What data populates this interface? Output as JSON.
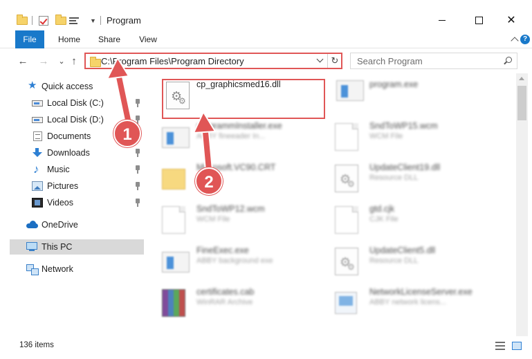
{
  "window": {
    "title": "Program",
    "controls": {
      "minimize": "—",
      "maximize": "☐",
      "close": "✕"
    }
  },
  "ribbon": {
    "tabs": [
      {
        "label": "File"
      },
      {
        "label": "Home"
      },
      {
        "label": "Share"
      },
      {
        "label": "View"
      }
    ],
    "help": "?"
  },
  "navigation": {
    "back": "←",
    "forward": "→",
    "recent": "⌄",
    "up": "↑",
    "address": "C:\\Program Files\\Program Directory",
    "refresh": "↻",
    "search_placeholder": "Search Program"
  },
  "sidebar": {
    "items": [
      {
        "label": "Quick access",
        "icon": "star-icon",
        "pinned": false
      },
      {
        "label": "Local Disk (C:)",
        "icon": "drive-icon",
        "pinned": true
      },
      {
        "label": "Local Disk (D:)",
        "icon": "drive-icon",
        "pinned": true
      },
      {
        "label": "Documents",
        "icon": "documents-icon",
        "pinned": true
      },
      {
        "label": "Downloads",
        "icon": "downloads-icon",
        "pinned": true
      },
      {
        "label": "Music",
        "icon": "music-icon",
        "pinned": true
      },
      {
        "label": "Pictures",
        "icon": "pictures-icon",
        "pinned": true
      },
      {
        "label": "Videos",
        "icon": "videos-icon",
        "pinned": true
      },
      {
        "label": "OneDrive",
        "icon": "cloud-icon",
        "pinned": false
      },
      {
        "label": "This PC",
        "icon": "computer-icon",
        "pinned": false,
        "selected": true
      },
      {
        "label": "Network",
        "icon": "network-icon",
        "pinned": false
      }
    ]
  },
  "files": [
    {
      "name": "cp_graphicsmed16.dll",
      "desc": "",
      "icon": "dll-file-icon"
    },
    {
      "name": "program.exe",
      "desc": "",
      "icon": "exe-file-icon"
    },
    {
      "name": "programmInstaller.exe",
      "desc": "ABBY fineeader In...",
      "icon": "exe-file-icon"
    },
    {
      "name": "SndToWP15.wcm",
      "desc": "WCM File",
      "icon": "wcm-file-icon"
    },
    {
      "name": "Microsoft.VC90.CRT",
      "desc": "",
      "icon": "folder-icon"
    },
    {
      "name": "UpdateClient19.dll",
      "desc": "Resource DLL",
      "icon": "dll-file-icon"
    },
    {
      "name": "SndToWP12.wcm",
      "desc": "WCM File",
      "icon": "wcm-file-icon"
    },
    {
      "name": "gtd.cjk",
      "desc": "CJK File",
      "icon": "cjk-file-icon"
    },
    {
      "name": "FineExec.exe",
      "desc": "ABBY background exe",
      "icon": "exe-file-icon"
    },
    {
      "name": "UpdateClient5.dll",
      "desc": "Resource DLL",
      "icon": "dll-file-icon"
    },
    {
      "name": "certificates.cab",
      "desc": "WinRAR Archive",
      "icon": "archive-icon"
    },
    {
      "name": "NetworkLicenseServer.exe",
      "desc": "ABBY network licens...",
      "icon": "exe-file-icon"
    }
  ],
  "status": {
    "item_count": "136 items"
  },
  "callouts": {
    "one": "1",
    "two": "2"
  },
  "colors": {
    "accent": "#1979ca",
    "highlight": "#e05656"
  }
}
